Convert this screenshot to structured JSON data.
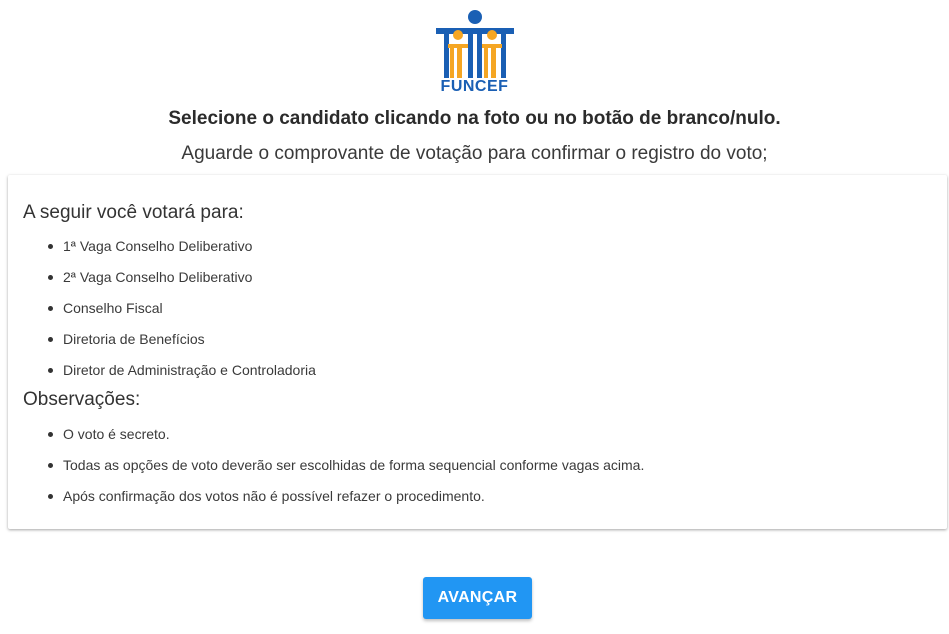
{
  "brand": {
    "logo_text": "FUNCEF",
    "colors": {
      "blue": "#1a5fb4",
      "orange": "#f5a623"
    }
  },
  "header": {
    "instruction": "Selecione o candidato clicando na foto ou no botão de branco/nulo.",
    "notice": "Aguarde o comprovante de votação para confirmar o registro do voto;"
  },
  "card": {
    "votes_title": "A seguir você votará para:",
    "votes": [
      "1ª Vaga Conselho Deliberativo",
      "2ª Vaga Conselho Deliberativo",
      "Conselho Fiscal",
      "Diretoria de Benefícios",
      "Diretor de Administração e Controladoria"
    ],
    "notes_title": "Observações:",
    "notes": [
      "O voto é secreto.",
      "Todas as opções de voto deverão ser escolhidas de forma sequencial conforme vagas acima.",
      "Após confirmação dos votos não é possível refazer o procedimento."
    ]
  },
  "actions": {
    "next_label": "AVANÇAR",
    "button_color": "#2196f3"
  }
}
